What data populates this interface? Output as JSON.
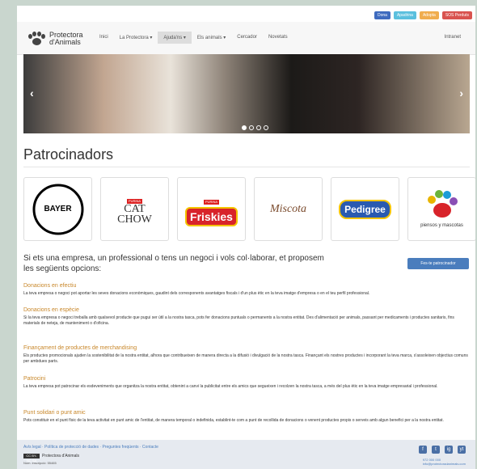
{
  "topbar": {
    "buttons": [
      {
        "label": "Dona",
        "color": "#3e6bbf"
      },
      {
        "label": "Apadrina",
        "color": "#5bc0de"
      },
      {
        "label": "Adopta",
        "color": "#f0ad4e"
      },
      {
        "label": "SOS Perduts",
        "color": "#d9534f"
      }
    ]
  },
  "nav": {
    "logo_line1": "Protectora",
    "logo_line2": "d'Animals",
    "items": [
      "Inici",
      "La Protectora ▾",
      "Ajuda'ns ▾",
      "Els animals ▾",
      "Cercador",
      "Novetats"
    ],
    "intranet": "Intranet"
  },
  "hero": {
    "prev": "‹",
    "next": "›"
  },
  "page_title": "Patrocinadors",
  "sponsors": {
    "bayer": "BAYER",
    "purina1": "PURINA",
    "catchow1": "CAT",
    "catchow2": "CHOW",
    "purina2": "PURINA",
    "friskies": "Friskies",
    "miscota": "Miscota",
    "pedigree": "Pedigree",
    "piensos": "piensos y mascotas"
  },
  "intro": "Si ets una empresa, un professional o tens un negoci i vols col·laborar, et proposem les següents opcions:",
  "cta": "Fes-te patrocinador",
  "sections": [
    {
      "title": "Donacions en efectiu",
      "text": "La teva empresa o negoci pot aportar les seves donacions econòmiques, gaudint dels corresponents avantatges fiscals i d'un plus ètic en la teva imatge d'empresa o en el teu perfil professional."
    },
    {
      "title": "Donacions en espècie",
      "text": "Si la teva empresa o negoci treballa amb qualsevol producte que pugui ser útil a la nostra tasca, pots fer donacions puntuals o permanents a la nostra entitat. Des d'alimentació per animals, passant per medicaments i productes sanitaris, fins materials de neteja, de manteniment o d'oficina."
    },
    {
      "title": "Finançament de productes de merchandising",
      "text": "Els productes promocionals ajuden la sostenibilitat de la nostra entitat, alhora que contribueixen de manera directa a la difusió i divulgació de la nostra tasca. Finançant els nostres productes i incorporant la teva marca, s'assoleixen objectius comuns per ambdues parts."
    },
    {
      "title": "Patrocini",
      "text": "La teva empresa pot patrocinar els esdeveniments que organitza la nostra entitat, obtenint a canvi la publicitat entre els amics que segueixen i recolzen la nostra tasca, a més del plus ètic en la teva imatge empresarial i professional."
    },
    {
      "title": "Punt solidari o punt amic",
      "text": "Pots constituir en el punt físic de la teva activitat en punt amic de l'entitat, de manera temporal o indefinida, establint-te com a punt de recollida de donacions o venent productes propis o serveis amb algun benefici per a la nostra entitat."
    }
  ],
  "footer": {
    "links": "Avís legal · Política de protecció de dades · Preguntes freqüents · Contacte",
    "cc": "CC BY-NC-SA",
    "brand": "Protectora d'Animals",
    "num": "Núm. inscripció: 55465",
    "social": [
      "f",
      "t",
      "ig",
      "yt"
    ],
    "phone": "972 000 000",
    "email": "info@protectoradanimals.com"
  }
}
